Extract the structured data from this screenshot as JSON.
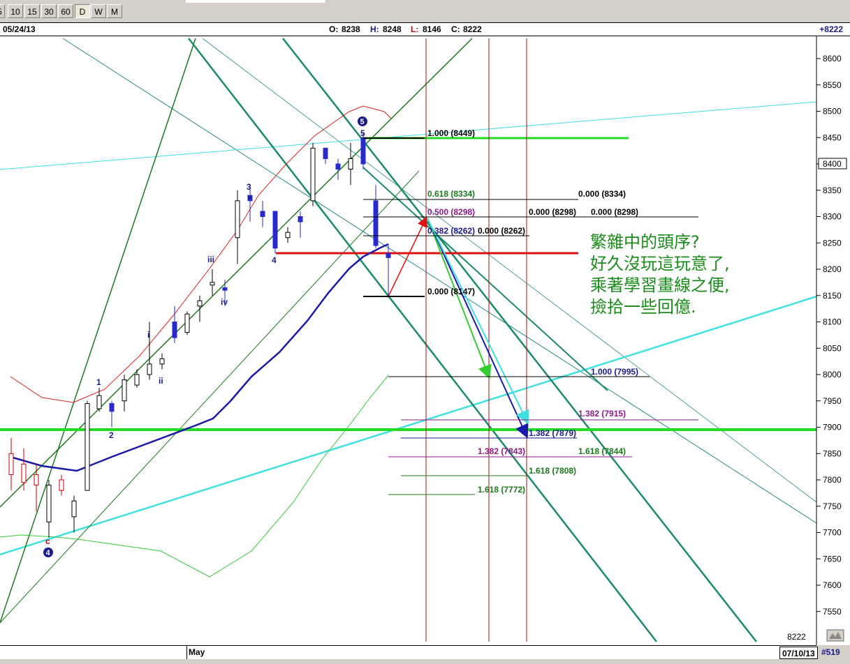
{
  "toolbar": {
    "timeframes": [
      {
        "label": "5"
      },
      {
        "label": "10"
      },
      {
        "label": "15"
      },
      {
        "label": "30"
      },
      {
        "label": "60"
      },
      {
        "label": "D",
        "active": true
      },
      {
        "label": "W"
      },
      {
        "label": "M"
      }
    ]
  },
  "infobar": {
    "date": "05/24/13",
    "open_label": "O:",
    "open": "8238",
    "high_label": "H:",
    "high": "8248",
    "low_label": "L:",
    "low": "8146",
    "close_label": "C:",
    "close": "8222",
    "last": "+8222"
  },
  "price_axis": {
    "ticks": [
      8600,
      8550,
      8500,
      8450,
      8400,
      8350,
      8300,
      8250,
      8200,
      8150,
      8100,
      8050,
      8000,
      7950,
      7900,
      7850,
      7800,
      7750,
      7700,
      7650,
      7600,
      7550
    ],
    "highlight": "8400",
    "bottom_value": "8222"
  },
  "fib_labels": [
    {
      "text": "1.000 (8449)",
      "color": "#000000"
    },
    {
      "text": "0.618 (8334)",
      "color": "#1a7a1a"
    },
    {
      "text": "0.000 (8334)",
      "color": "#000000"
    },
    {
      "text": "0.500 (8298)",
      "color": "#8b1a8b"
    },
    {
      "text": "0.000 (8298)",
      "color": "#000000"
    },
    {
      "text": "0.000 (8298)",
      "color": "#000000"
    },
    {
      "text": "0.382 (8262)",
      "color": "#1a1a8b"
    },
    {
      "text": "0.000 (8262)",
      "color": "#000000"
    },
    {
      "text": "0.000 (8147)",
      "color": "#000000"
    },
    {
      "text": "1.000 (7995)",
      "color": "#1a1a8b"
    },
    {
      "text": "1.382 (7915)",
      "color": "#8b1a8b"
    },
    {
      "text": "1.382 (7879)",
      "color": "#1a1a8b"
    },
    {
      "text": "1.618 (7844)",
      "color": "#1a7a1a"
    },
    {
      "text": "1.382 (7843)",
      "color": "#8b1a8b"
    },
    {
      "text": "1.618 (7808)",
      "color": "#1a7a1a"
    },
    {
      "text": "1.618 (7772)",
      "color": "#1a7a1a"
    }
  ],
  "wave_labels": [
    {
      "text": "1",
      "color": "#1a1a8b"
    },
    {
      "text": "2",
      "color": "#1a1a8b"
    },
    {
      "text": "3",
      "color": "#1a1a8b"
    },
    {
      "text": "4",
      "color": "#1a1a8b"
    },
    {
      "text": "5",
      "color": "#1a1a8b"
    },
    {
      "text": "i",
      "color": "#1a1a8b"
    },
    {
      "text": "ii",
      "color": "#1a1a8b"
    },
    {
      "text": "iii",
      "color": "#1a1a8b"
    },
    {
      "text": "iv",
      "color": "#1a1a8b"
    },
    {
      "text": "v",
      "color": "#1a1a8b"
    },
    {
      "text": "c",
      "color": "#cc0000"
    },
    {
      "text": "4",
      "color": "#1a1a8b",
      "circled": true
    },
    {
      "text": "5",
      "color": "#1a1a8b",
      "circled": true
    }
  ],
  "annotation": {
    "lines": [
      "繁雜中的頭序?",
      "好久沒玩這玩意了,",
      "乘著學習畫線之便,",
      "撿拾一些回億."
    ],
    "color": "#1a8c1a"
  },
  "bottom": {
    "month": "May",
    "end_date": "07/10/13",
    "bar_count": "#519"
  },
  "colors": {
    "channel": "#1a8a6a",
    "fan": "#2a8a8a",
    "cyan": "#40e0e0",
    "green_level": "#22dd22",
    "red_level": "#dd1111",
    "ma_blue": "#1a1aa8",
    "ma_red": "#dd2222",
    "ma_green": "#33cc33",
    "time_line": "#aa1111",
    "up_candle": "#ffffff",
    "down_candle": "#2a2acc"
  }
}
